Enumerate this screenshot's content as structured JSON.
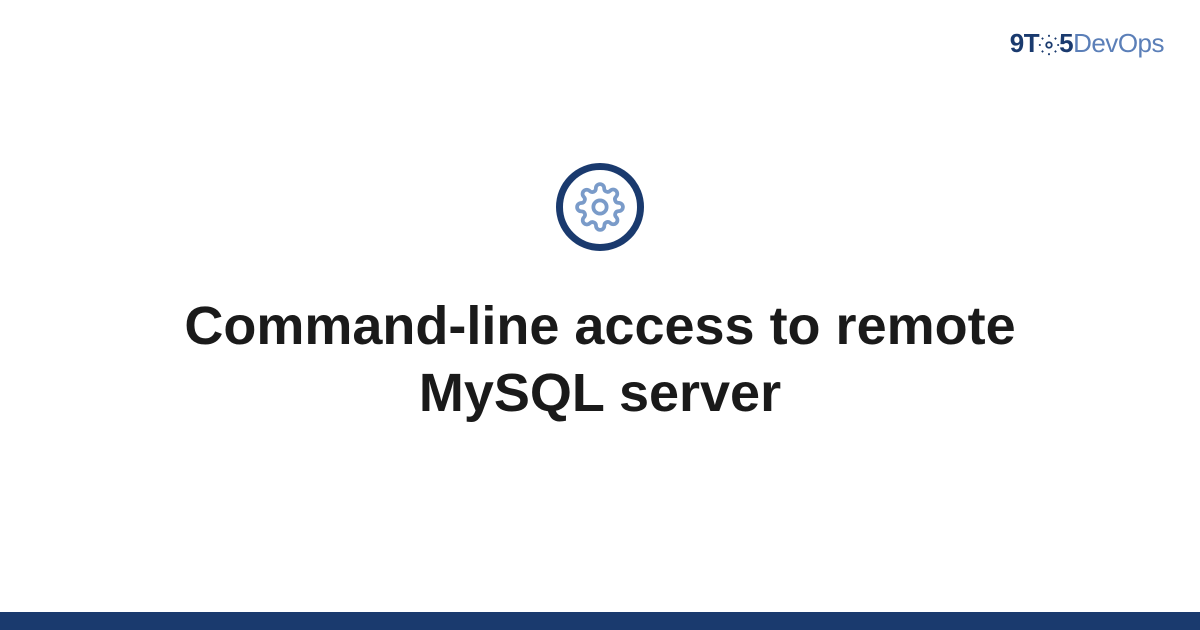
{
  "logo": {
    "nine": "9",
    "t": "T",
    "five": "5",
    "dev": "Dev",
    "ops": "Ops"
  },
  "title": "Command-line access to remote MySQL server",
  "colors": {
    "brand_dark": "#1a3a6e",
    "brand_light": "#5b7fb8"
  }
}
